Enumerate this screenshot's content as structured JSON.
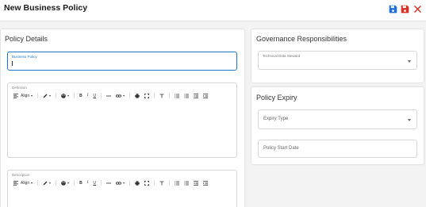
{
  "header": {
    "title": "New Business Policy",
    "actions": [
      {
        "name": "save-icon",
        "color": "#1e6fd9"
      },
      {
        "name": "save-close-icon",
        "color": "#d93025"
      },
      {
        "name": "close-icon",
        "color": "#d93025"
      }
    ]
  },
  "policy_details": {
    "title": "Policy Details",
    "business_policy": {
      "label": "Business Policy",
      "value": ""
    },
    "definition": {
      "label": "Definition"
    },
    "description": {
      "label": "Description"
    }
  },
  "editor_toolbar": {
    "align_label": "Align",
    "tools": [
      "align-icon",
      "pen-icon",
      "palette-icon",
      "bold-icon",
      "italic-icon",
      "underline-icon",
      "horizontal-rule-icon",
      "link-icon",
      "print-icon",
      "fullscreen-icon",
      "clear-format-icon",
      "bullet-list-icon",
      "numbered-list-icon",
      "outdent-icon",
      "indent-icon"
    ],
    "bold": "B",
    "italic": "I",
    "underline": "U"
  },
  "governance": {
    "title": "Governance Responsibilities",
    "technical_data_steward": {
      "label": "Technical Data Steward",
      "value": ""
    }
  },
  "policy_expiry": {
    "title": "Policy Expiry",
    "expiry_type": {
      "placeholder": "Expiry Type"
    },
    "policy_start_date": {
      "placeholder": "Policy Start Date"
    }
  },
  "colors": {
    "accent": "#1e78c8",
    "background": "#f3f3f3",
    "card": "#ffffff"
  }
}
